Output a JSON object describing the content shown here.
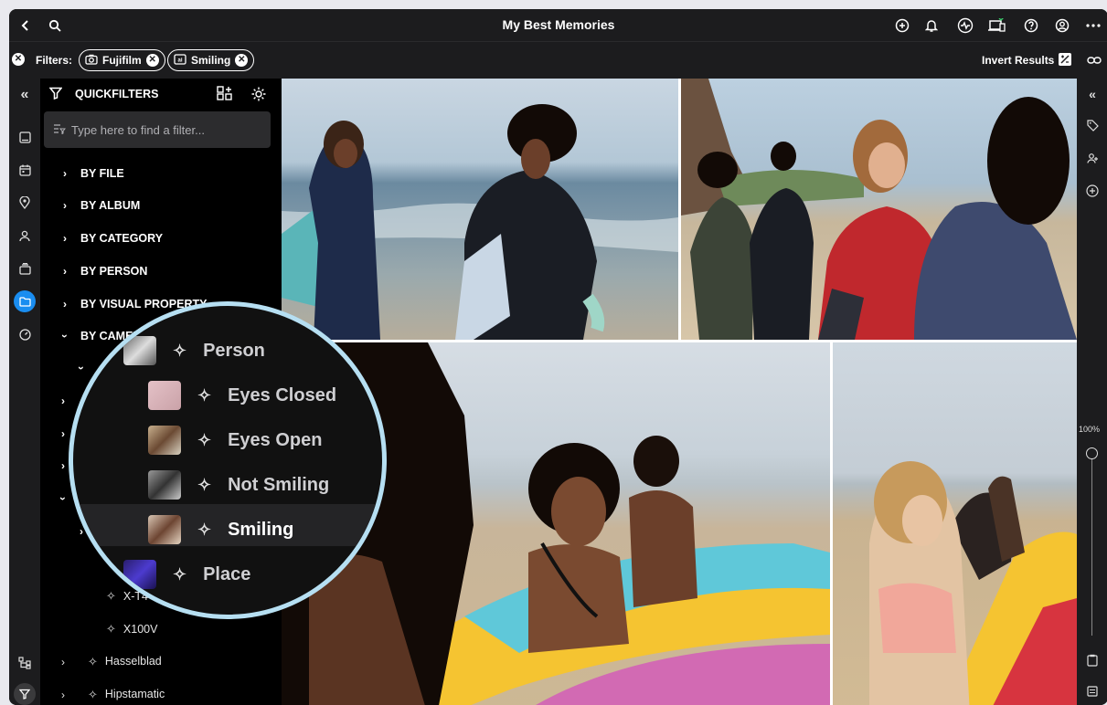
{
  "app": {
    "title": "My Best Memories"
  },
  "filters": {
    "label": "Filters:",
    "chips": [
      {
        "label": "Fujifilm"
      },
      {
        "label": "Smiling"
      }
    ],
    "invert_label": "Invert Results"
  },
  "sidebar": {
    "header": "QUICKFILTERS",
    "search_placeholder": "Type here to find a filter...",
    "items": [
      {
        "label": "BY FILE"
      },
      {
        "label": "BY ALBUM"
      },
      {
        "label": "BY CATEGORY"
      },
      {
        "label": "BY PERSON"
      },
      {
        "label": "BY VISUAL PROPERTY"
      },
      {
        "label": "BY CAMERA"
      }
    ],
    "camera_models": [
      {
        "label": "X-T4"
      },
      {
        "label": "X100V"
      }
    ],
    "camera_makers": [
      {
        "label": "Hasselblad"
      },
      {
        "label": "Hipstamatic"
      }
    ]
  },
  "magnifier": {
    "rows": [
      {
        "label": "Person"
      },
      {
        "label": "Eyes Closed"
      },
      {
        "label": "Eyes Open"
      },
      {
        "label": "Not Smiling"
      },
      {
        "label": "Smiling"
      },
      {
        "label": "Place"
      }
    ]
  },
  "right_rail": {
    "zoom_label": "100%"
  },
  "colors": {
    "accent": "#1a8df0",
    "bg": "#1c1c1e",
    "magnifier_ring": "#b6dff2"
  }
}
